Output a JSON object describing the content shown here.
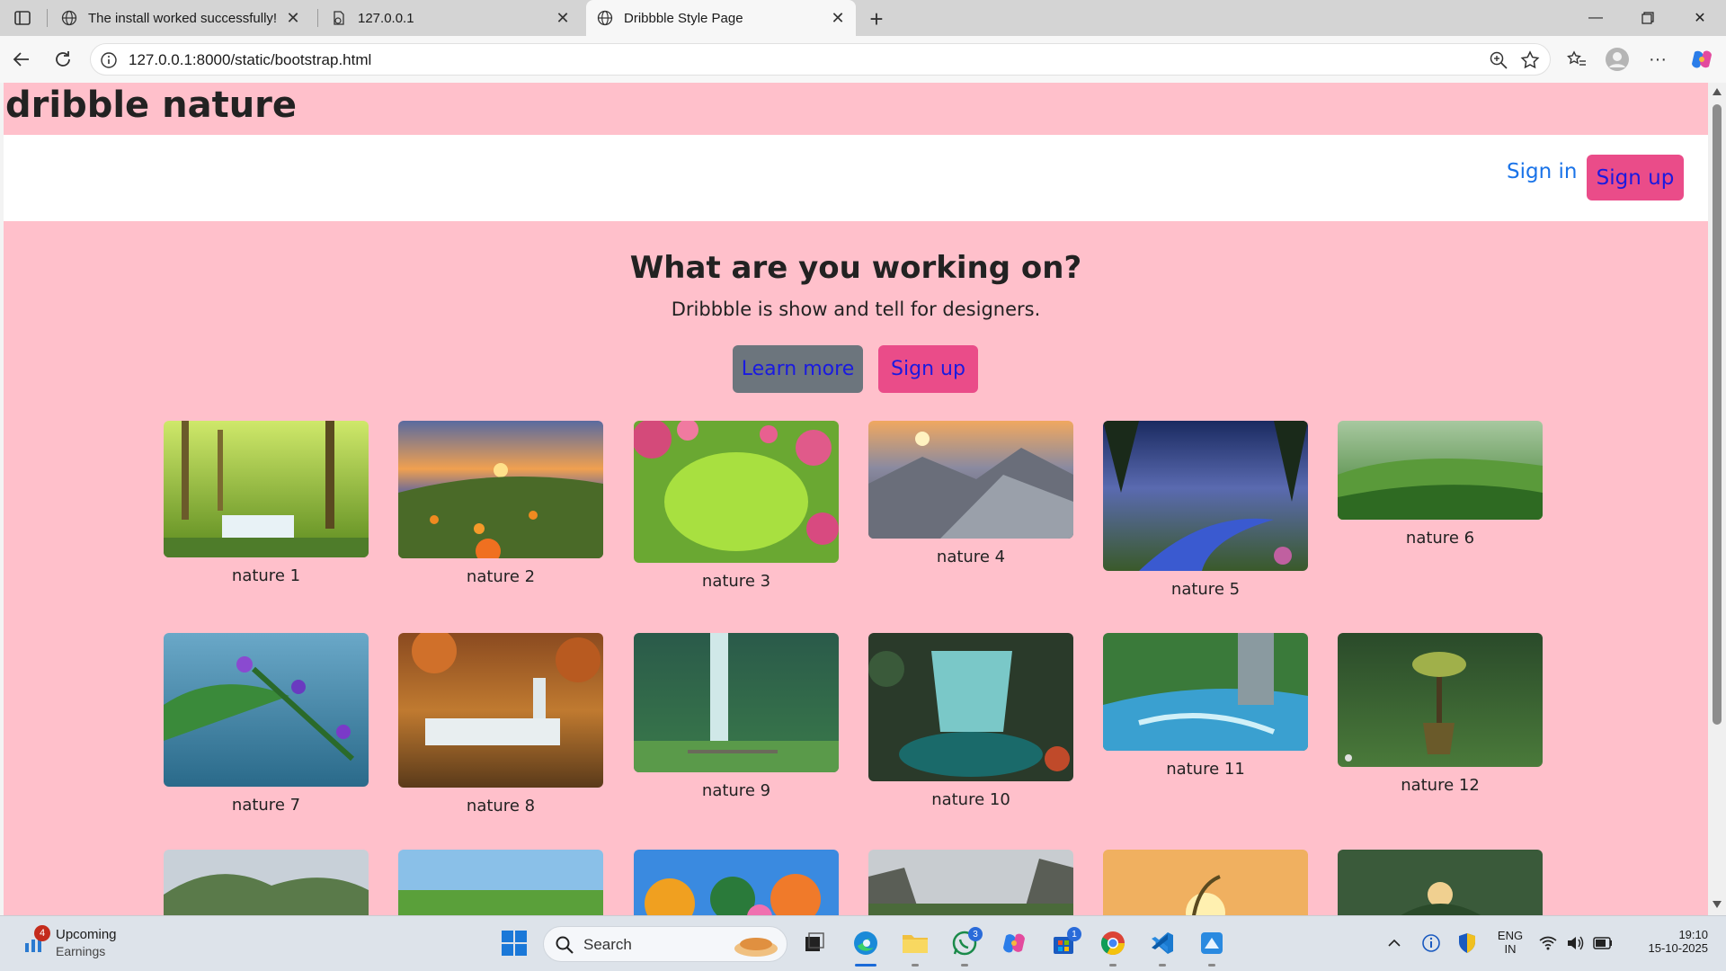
{
  "browser": {
    "tabs": [
      {
        "title": "The install worked successfully! Co",
        "active": false
      },
      {
        "title": "127.0.0.1",
        "active": false
      },
      {
        "title": "Dribbble Style Page",
        "active": true
      }
    ],
    "url": "127.0.0.1:8000/static/bootstrap.html"
  },
  "site": {
    "title": "dribble nature",
    "nav": {
      "signin": "Sign in",
      "signup": "Sign up"
    },
    "hero": {
      "title": "What are you working on?",
      "subtitle": "Dribbble is show and tell for designers.",
      "learn_more": "Learn more",
      "signup": "Sign up"
    },
    "gallery": [
      {
        "caption": "nature 1"
      },
      {
        "caption": "nature 2"
      },
      {
        "caption": "nature 3"
      },
      {
        "caption": "nature 4"
      },
      {
        "caption": "nature 5"
      },
      {
        "caption": "nature 6"
      },
      {
        "caption": "nature 7"
      },
      {
        "caption": "nature 8"
      },
      {
        "caption": "nature 9"
      },
      {
        "caption": "nature 10"
      },
      {
        "caption": "nature 11"
      },
      {
        "caption": "nature 12"
      }
    ]
  },
  "taskbar": {
    "weather": {
      "line1": "Upcoming",
      "line2": "Earnings",
      "badge": "4"
    },
    "search_placeholder": "Search",
    "whatsapp_badge": "3",
    "store_badge": "1",
    "lang_line1": "ENG",
    "lang_line2": "IN",
    "time": "19:10",
    "date": "15-10-2025"
  },
  "colors": {
    "page_bg": "#ffc0cb",
    "accent_pink": "#ea4c89",
    "link_blue": "#1a73e8",
    "secondary_gray": "#6c757d"
  }
}
